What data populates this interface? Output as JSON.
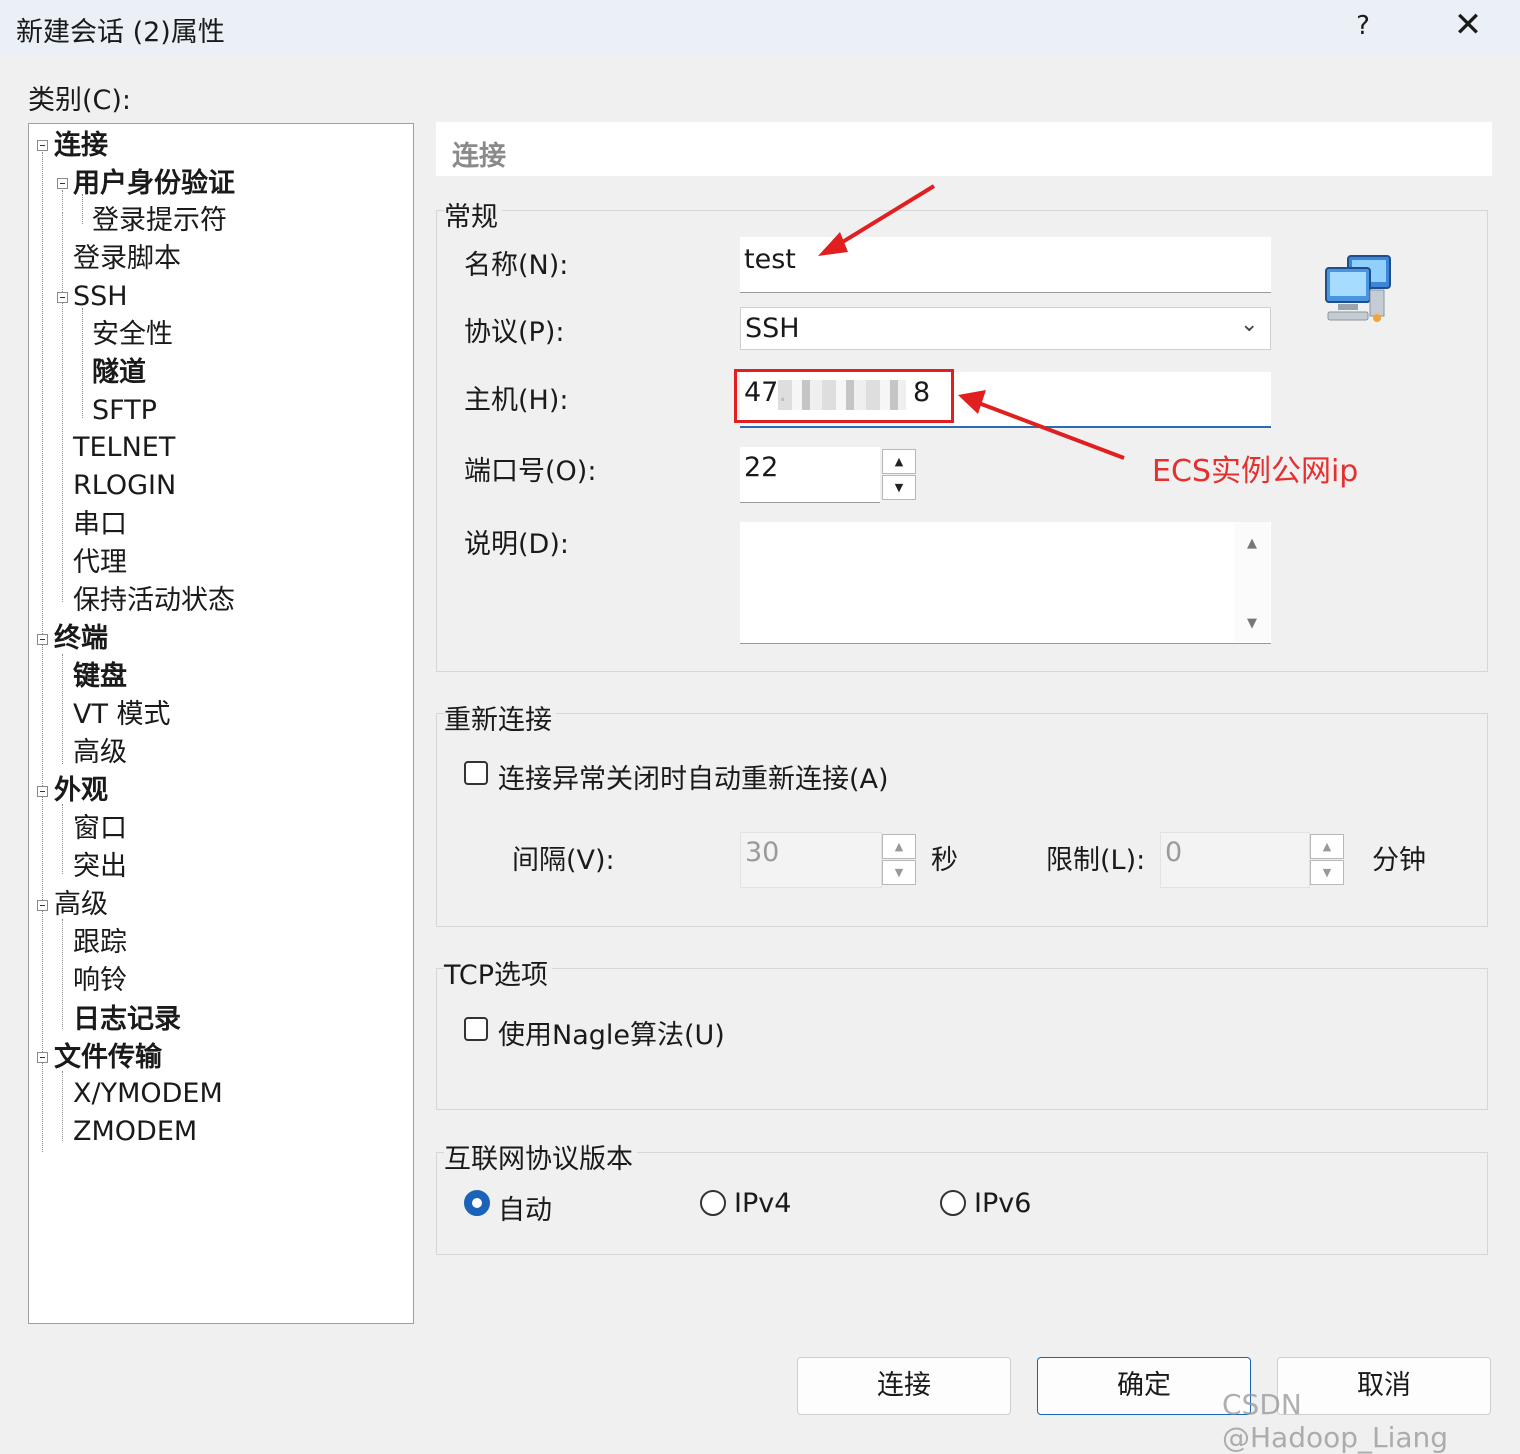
{
  "window": {
    "title": "新建会话 (2)属性",
    "help_label": "?",
    "close_label": "✕"
  },
  "category_label": "类别(C):",
  "tree": {
    "items": [
      {
        "label": "连接"
      },
      {
        "label": "用户身份验证"
      },
      {
        "label": "登录提示符"
      },
      {
        "label": "登录脚本"
      },
      {
        "label": "SSH"
      },
      {
        "label": "安全性"
      },
      {
        "label": "隧道"
      },
      {
        "label": "SFTP"
      },
      {
        "label": "TELNET"
      },
      {
        "label": "RLOGIN"
      },
      {
        "label": "串口"
      },
      {
        "label": "代理"
      },
      {
        "label": "保持活动状态"
      },
      {
        "label": "终端"
      },
      {
        "label": "键盘"
      },
      {
        "label": "VT 模式"
      },
      {
        "label": "高级"
      },
      {
        "label": "外观"
      },
      {
        "label": "窗口"
      },
      {
        "label": "突出"
      },
      {
        "label": "高级"
      },
      {
        "label": "跟踪"
      },
      {
        "label": "响铃"
      },
      {
        "label": "日志记录"
      },
      {
        "label": "文件传输"
      },
      {
        "label": "X/YMODEM"
      },
      {
        "label": "ZMODEM"
      }
    ]
  },
  "panel": {
    "section_title": "连接",
    "general": {
      "group_label": "常规",
      "name_label": "名称(N):",
      "name_value": "test",
      "protocol_label": "协议(P):",
      "protocol_value": "SSH",
      "host_label": "主机(H):",
      "host_value_start": "47.",
      "host_value_end": "8",
      "port_label": "端口号(O):",
      "port_value": "22",
      "desc_label": "说明(D):",
      "desc_value": ""
    },
    "reconnect": {
      "group_label": "重新连接",
      "auto_reconnect_label": "连接异常关闭时自动重新连接(A)",
      "auto_reconnect_checked": false,
      "interval_label": "间隔(V):",
      "interval_value": "30",
      "interval_unit": "秒",
      "limit_label": "限制(L):",
      "limit_value": "0",
      "limit_unit": "分钟"
    },
    "tcp": {
      "group_label": "TCP选项",
      "nagle_label": "使用Nagle算法(U)",
      "nagle_checked": false
    },
    "ip_version": {
      "group_label": "互联网协议版本",
      "options": [
        "自动",
        "IPv4",
        "IPv6"
      ],
      "selected": "自动"
    }
  },
  "buttons": {
    "connect": "连接",
    "ok": "确定",
    "cancel": "取消"
  },
  "annotation": {
    "text": "ECS实例公网ip",
    "color": "#e53030"
  },
  "watermark": "CSDN @Hadoop_Liang",
  "icons": {
    "network": "network-computers-icon",
    "dropdown": "chevron-down-icon",
    "spin_up": "triangle-up-icon",
    "spin_down": "triangle-down-icon"
  }
}
